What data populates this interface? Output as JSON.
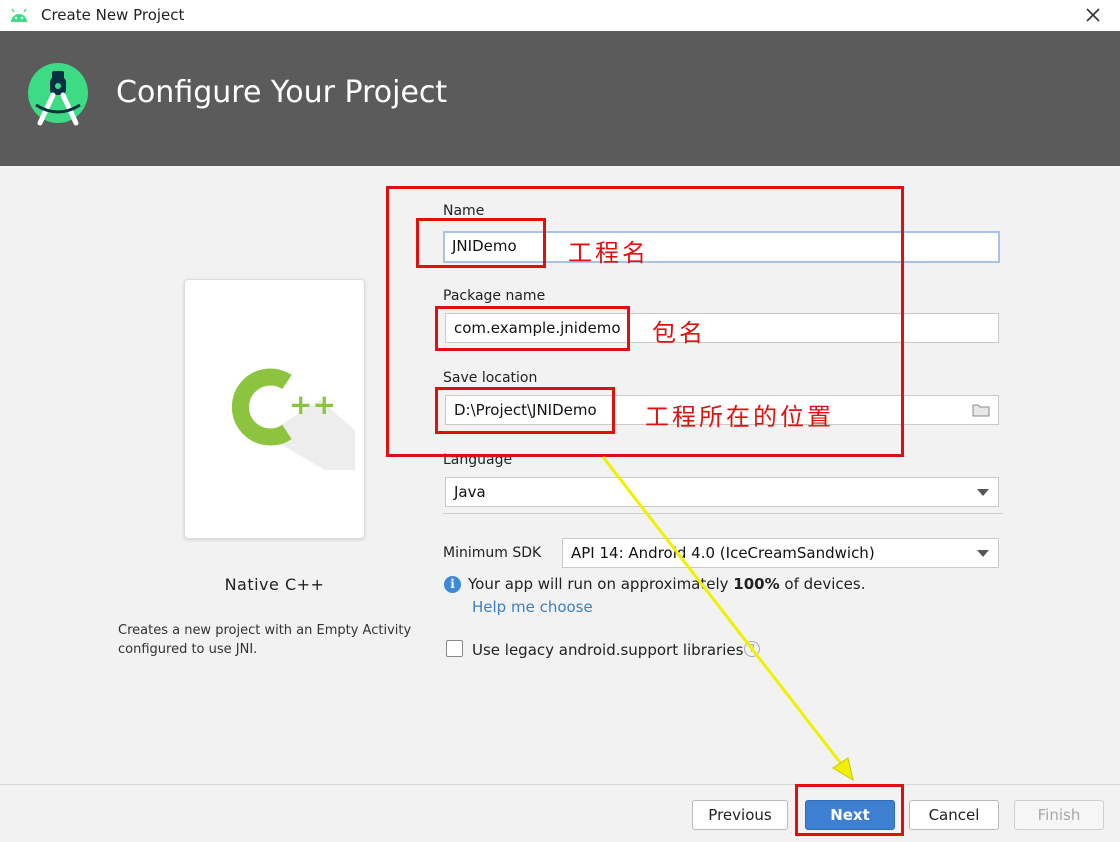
{
  "window": {
    "title": "Create New Project",
    "close_icon": "close-icon",
    "app_icon": "android-icon"
  },
  "header": {
    "heading": "Configure Your Project",
    "logo_icon": "android-studio-logo-icon"
  },
  "template": {
    "name": "Native C++",
    "description_line1": "Creates a new project with an Empty Activity",
    "description_line2": "configured to use JNI.",
    "icon": "cpp-icon"
  },
  "form": {
    "name_label": "Name",
    "name_value": "JNIDemo",
    "package_label": "Package name",
    "package_value": "com.example.jnidemo",
    "location_label": "Save location",
    "location_value": "D:\\Project\\JNIDemo",
    "language_label": "Language",
    "language_value": "Java",
    "min_sdk_label": "Minimum SDK",
    "min_sdk_value": "API 14: Android 4.0 (IceCreamSandwich)",
    "info_pre": "Your app will run on approximately ",
    "info_bold": "100%",
    "info_post": " of devices.",
    "help_link": "Help me choose",
    "legacy_label": "Use legacy android.support libraries",
    "legacy_checked": false
  },
  "buttons": {
    "previous": "Previous",
    "next": "Next",
    "cancel": "Cancel",
    "finish": "Finish"
  },
  "annotations": {
    "name_note": "工程名",
    "package_note": "包名",
    "location_note": "工程所在的位置"
  },
  "colors": {
    "banner": "#5b5b5b",
    "annotation_red": "#e01010",
    "arrow_yellow": "#f0f000",
    "primary_button": "#3d7fd0",
    "android_green": "#3ddc84",
    "cpp_green": "#8cc43f"
  }
}
